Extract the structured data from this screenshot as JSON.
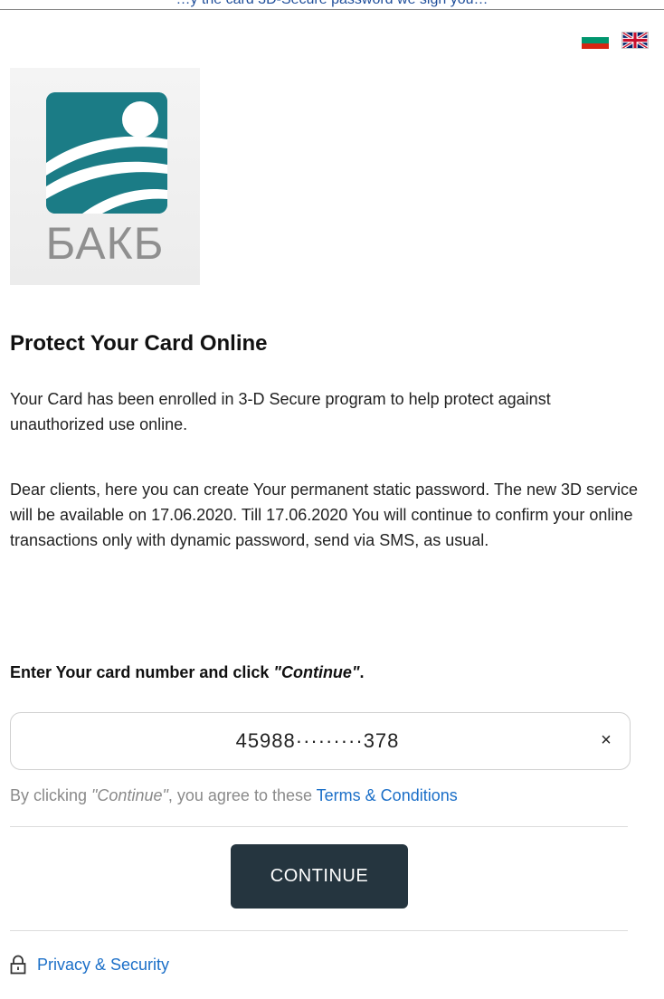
{
  "top_strip": {
    "text": "…y the card 3D-Secure password we sign you…"
  },
  "flags": {
    "bulgarian": {
      "icon": "bulgarian-flag-icon",
      "colors": [
        "#ffffff",
        "#00966e",
        "#d62612"
      ]
    },
    "english": {
      "icon": "uk-flag-icon",
      "colors": [
        "#012169",
        "#ffffff",
        "#c8102e"
      ]
    }
  },
  "logo": {
    "text": "БАКБ",
    "tile_color": "#1b7c86",
    "text_color": "#8f8f8f"
  },
  "heading": "Protect Your Card Online",
  "paragraphs": {
    "p1": "Your Card has been enrolled in 3-D Secure program to help protect against unauthorized use online.",
    "p2": "Dear clients, here you can create Your permanent static password. The new 3D service will be available on 17.06.2020. Till 17.06.2020 You will continue to confirm your online transactions only with dynamic password, send via SMS, as usual."
  },
  "instruction": {
    "prefix": "Enter Your card number and click ",
    "emphasis": "\"Continue\"",
    "suffix": "."
  },
  "card_input": {
    "value": "45988·········378",
    "clear_icon": "×"
  },
  "terms": {
    "prefix": "By clicking ",
    "emphasis": "\"Continue\"",
    "middle": ", you agree to these ",
    "link": "Terms & Conditions"
  },
  "continue_button": {
    "label": "CONTINUE",
    "color": "#25353f"
  },
  "privacy": {
    "label": "Privacy & Security",
    "icon": "lock-icon",
    "link_color": "#1b6fc8"
  }
}
